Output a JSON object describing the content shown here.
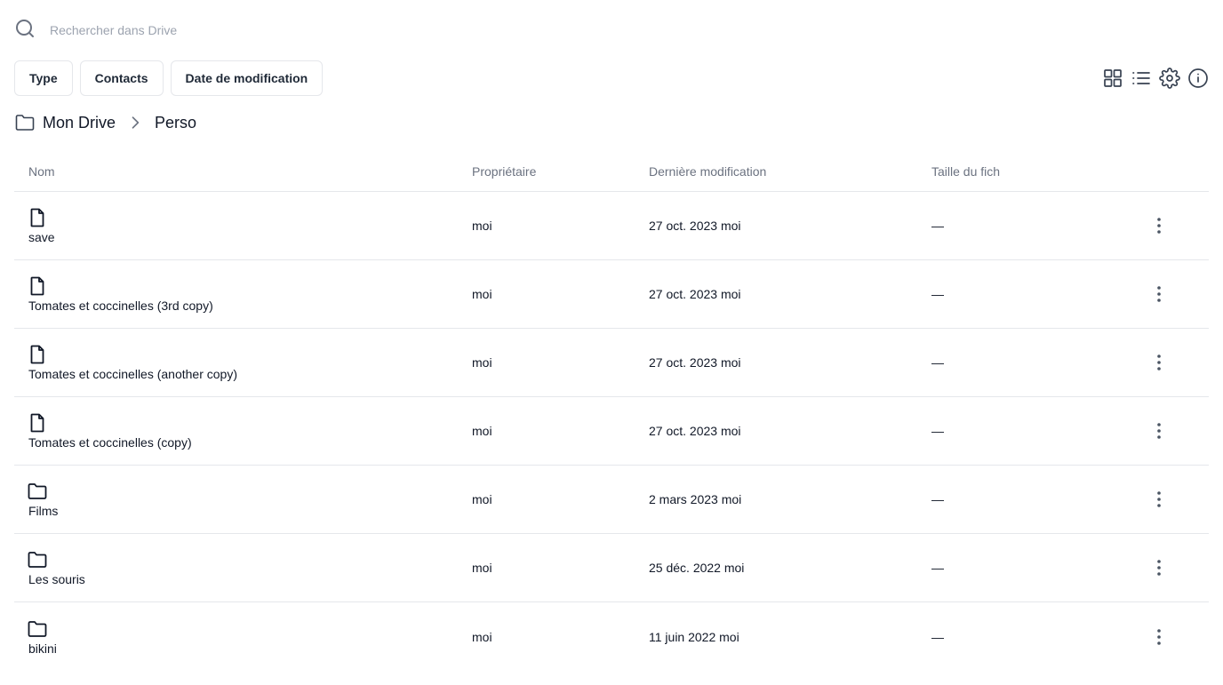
{
  "search": {
    "placeholder": "Rechercher dans Drive",
    "icon": "search-icon"
  },
  "filters": [
    {
      "label": "Type"
    },
    {
      "label": "Contacts"
    },
    {
      "label": "Date de modification"
    }
  ],
  "toolbar": {
    "icons": [
      "grid-view-icon",
      "list-view-icon",
      "gear-icon",
      "info-icon"
    ]
  },
  "breadcrumb": {
    "root": "Mon Drive",
    "current": "Perso"
  },
  "table": {
    "headers": {
      "name": "Nom",
      "owner": "Propriétaire",
      "modified": "Dernière modification",
      "size": "Taille du fich"
    },
    "rows": [
      {
        "type": "file",
        "name": "save",
        "owner": "moi",
        "modified": "27 oct. 2023 moi",
        "size": "—"
      },
      {
        "type": "file",
        "name": "Tomates et coccinelles (3rd copy)",
        "owner": "moi",
        "modified": "27 oct. 2023 moi",
        "size": "—"
      },
      {
        "type": "file",
        "name": "Tomates et coccinelles (another copy)",
        "owner": "moi",
        "modified": "27 oct. 2023 moi",
        "size": "—"
      },
      {
        "type": "file",
        "name": "Tomates et coccinelles (copy)",
        "owner": "moi",
        "modified": "27 oct. 2023 moi",
        "size": "—"
      },
      {
        "type": "folder",
        "name": "Films",
        "owner": "moi",
        "modified": "2 mars 2023 moi",
        "size": "—"
      },
      {
        "type": "folder",
        "name": "Les souris",
        "owner": "moi",
        "modified": "25 déc. 2022 moi",
        "size": "—"
      },
      {
        "type": "folder",
        "name": "bikini",
        "owner": "moi",
        "modified": "11 juin 2022 moi",
        "size": "—"
      }
    ]
  },
  "colors": {
    "border": "#e5e7eb",
    "muted": "#6b7280",
    "text": "#111827"
  }
}
